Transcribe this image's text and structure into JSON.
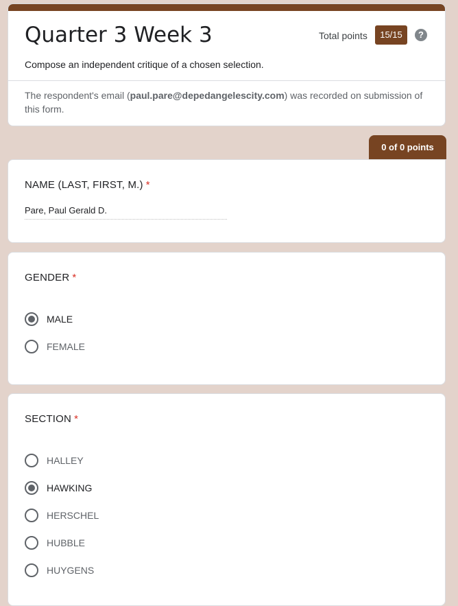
{
  "header": {
    "title": "Quarter 3 Week 3",
    "total_points_label": "Total points",
    "score": "15/15",
    "help_glyph": "?",
    "description": "Compose an independent critique of a chosen selection.",
    "email_prefix": "The respondent's email (",
    "email": "paul.pare@depedangelescity.com",
    "email_suffix": ") was recorded on submission of this form."
  },
  "section_score": "0 of 0 points",
  "questions": {
    "name": {
      "title": "NAME (LAST, FIRST, M.)",
      "required_mark": "*",
      "answer": "Pare, Paul Gerald D."
    },
    "gender": {
      "title": "GENDER",
      "required_mark": "*",
      "options": [
        {
          "label": "MALE",
          "selected": true
        },
        {
          "label": "FEMALE",
          "selected": false
        }
      ]
    },
    "section": {
      "title": "SECTION",
      "required_mark": "*",
      "options": [
        {
          "label": "HALLEY",
          "selected": false
        },
        {
          "label": "HAWKING",
          "selected": true
        },
        {
          "label": "HERSCHEL",
          "selected": false
        },
        {
          "label": "HUBBLE",
          "selected": false
        },
        {
          "label": "HUYGENS",
          "selected": false
        }
      ]
    }
  },
  "colors": {
    "background": "#e3d3cb",
    "accent": "#774422",
    "required": "#d93025"
  }
}
